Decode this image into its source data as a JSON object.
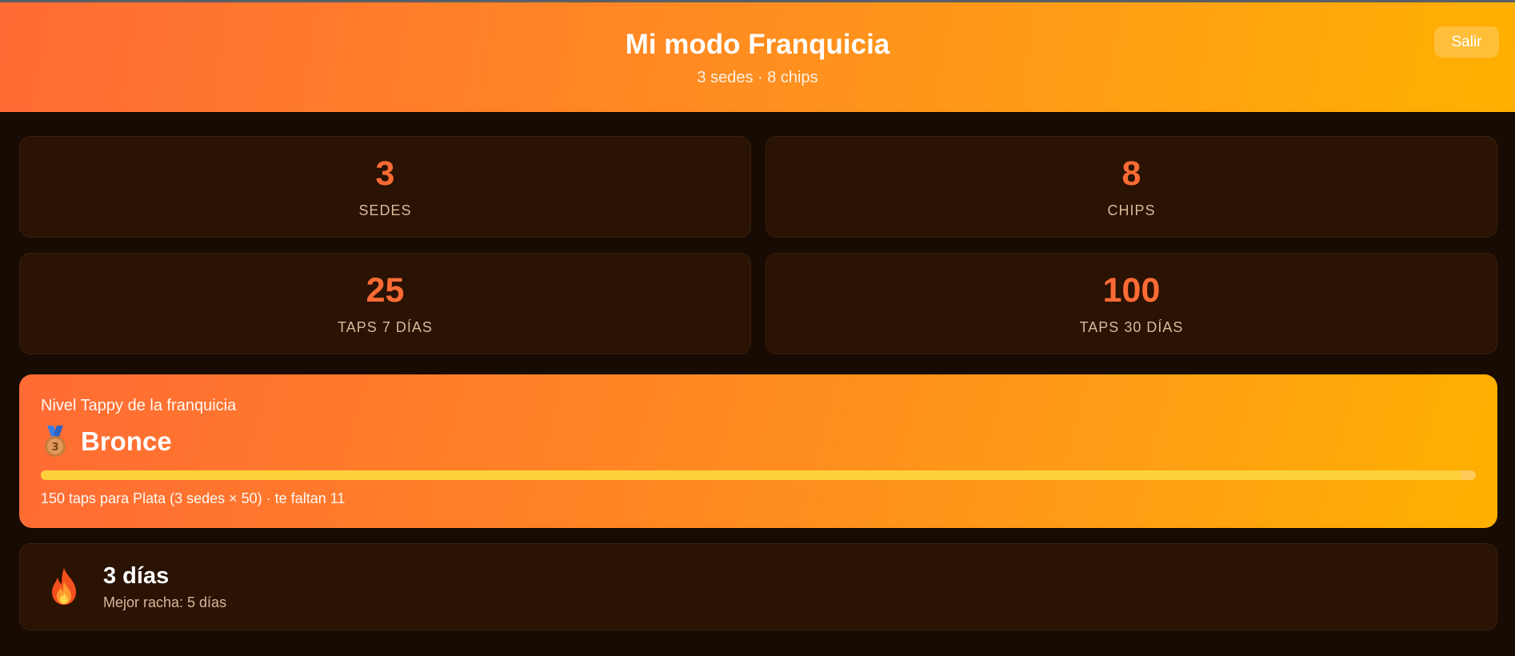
{
  "header": {
    "title": "Mi modo Franquicia",
    "subtitle": "3 sedes · 8 chips",
    "logout_label": "Salir"
  },
  "stats": [
    {
      "value": "3",
      "label": "SEDES"
    },
    {
      "value": "8",
      "label": "CHIPS"
    },
    {
      "value": "25",
      "label": "TAPS 7 DÍAS"
    },
    {
      "value": "100",
      "label": "TAPS 30 DÍAS"
    }
  ],
  "level": {
    "caption": "Nivel Tappy de la franquicia",
    "icon": "bronze-medal-icon",
    "name": "Bronce",
    "progress_percent": 99,
    "note": "150 taps para Plata (3 sedes × 50) · te faltan 11"
  },
  "streak": {
    "icon": "fire-icon",
    "title": "3 días",
    "subtitle": "Mejor racha: 5 días"
  },
  "colors": {
    "accent": "#ff6b35",
    "accent_end": "#ffb000",
    "background": "#170b04",
    "card": "#2a1303",
    "progress": "#fdd13a"
  }
}
